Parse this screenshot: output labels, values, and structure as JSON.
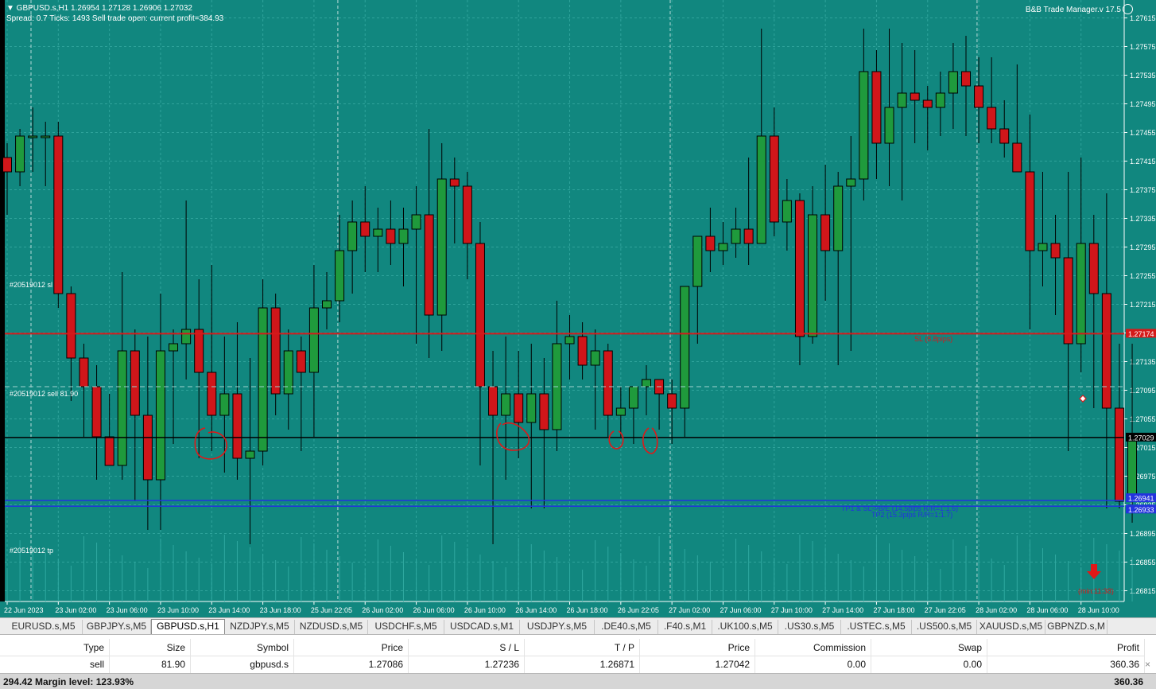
{
  "theme": {
    "chart_background": "#11877f",
    "bull_color": "#1f9a3c",
    "bear_color": "#d0161a",
    "grid_color": "#2fa39b",
    "sl_line_color": "#d51a1a",
    "price_line_color": "#000000",
    "tp_line_color": "#2233dd",
    "annotation_color": "#e01818"
  },
  "chart_header": {
    "line1": "▼ GBPUSD.s,H1  1.26954 1.27128 1.26906 1.27032",
    "line2": "Spread: 0.7  Ticks: 1493  Sell trade open: current profit=384.93",
    "ea_label": "B&B Trade Manager.v 17.5"
  },
  "order_labels": {
    "sl": "#20519012 sl",
    "entry": "#20519012 sell 81.90",
    "tp": "#20519012 tp"
  },
  "line_texts": {
    "sl": "SL (8.8pips)",
    "tp1": "TP1 & SL->B/E (14.5pips R/R=1:1.6)",
    "tp2": "TP2 (15.3pips R/R=1:1.7)",
    "timer": "(min:11:38)"
  },
  "chart_data": {
    "type": "candlestick",
    "symbol": "GBPUSD.s",
    "timeframe": "H1",
    "ylim": [
      1.2681,
      1.2763
    ],
    "y_ticks": [
      1.27615,
      1.27575,
      1.27535,
      1.27495,
      1.27455,
      1.27415,
      1.27375,
      1.27335,
      1.27295,
      1.27255,
      1.27215,
      1.27175,
      1.27135,
      1.27095,
      1.27055,
      1.27015,
      1.26975,
      1.26935,
      1.26895,
      1.26855,
      1.26815
    ],
    "x_labels": [
      {
        "i": 0,
        "label": "22 Jun 2023"
      },
      {
        "i": 4,
        "label": "23 Jun 02:00"
      },
      {
        "i": 8,
        "label": "23 Jun 06:00"
      },
      {
        "i": 12,
        "label": "23 Jun 10:00"
      },
      {
        "i": 16,
        "label": "23 Jun 14:00"
      },
      {
        "i": 20,
        "label": "23 Jun 18:00"
      },
      {
        "i": 24,
        "label": "25 Jun 22:05"
      },
      {
        "i": 28,
        "label": "26 Jun 02:00"
      },
      {
        "i": 32,
        "label": "26 Jun 06:00"
      },
      {
        "i": 36,
        "label": "26 Jun 10:00"
      },
      {
        "i": 40,
        "label": "26 Jun 14:00"
      },
      {
        "i": 44,
        "label": "26 Jun 18:00"
      },
      {
        "i": 48,
        "label": "26 Jun 22:05"
      },
      {
        "i": 52,
        "label": "27 Jun 02:00"
      },
      {
        "i": 56,
        "label": "27 Jun 06:00"
      },
      {
        "i": 60,
        "label": "27 Jun 10:00"
      },
      {
        "i": 64,
        "label": "27 Jun 14:00"
      },
      {
        "i": 68,
        "label": "27 Jun 18:00"
      },
      {
        "i": 72,
        "label": "27 Jun 22:05"
      },
      {
        "i": 76,
        "label": "28 Jun 02:00"
      },
      {
        "i": 80,
        "label": "28 Jun 06:00"
      },
      {
        "i": 84,
        "label": "28 Jun 10:00"
      }
    ],
    "period_separators": [
      0,
      24,
      50,
      74
    ],
    "candles": [
      [
        1.2742,
        1.2744,
        1.2734,
        1.274
      ],
      [
        1.274,
        1.2746,
        1.2738,
        1.2745
      ],
      [
        1.2745,
        1.2749,
        1.274,
        1.2745
      ],
      [
        1.2745,
        1.2747,
        1.2738,
        1.2745
      ],
      [
        1.2745,
        1.2747,
        1.2721,
        1.2723
      ],
      [
        1.2723,
        1.2724,
        1.2708,
        1.2714
      ],
      [
        1.2714,
        1.2716,
        1.2703,
        1.271
      ],
      [
        1.271,
        1.2713,
        1.2697,
        1.2703
      ],
      [
        1.2703,
        1.2709,
        1.2701,
        1.2699
      ],
      [
        1.2699,
        1.2726,
        1.2697,
        1.2715
      ],
      [
        1.2715,
        1.2718,
        1.2694,
        1.2706
      ],
      [
        1.2706,
        1.2717,
        1.269,
        1.2697
      ],
      [
        1.2697,
        1.2723,
        1.269,
        1.2715
      ],
      [
        1.2715,
        1.2718,
        1.2702,
        1.2716
      ],
      [
        1.2716,
        1.2736,
        1.2711,
        1.2718
      ],
      [
        1.2718,
        1.2725,
        1.27,
        1.2712
      ],
      [
        1.2712,
        1.2727,
        1.2701,
        1.2706
      ],
      [
        1.2706,
        1.2717,
        1.2698,
        1.2709
      ],
      [
        1.2709,
        1.2719,
        1.2697,
        1.27
      ],
      [
        1.27,
        1.2714,
        1.2688,
        1.2701
      ],
      [
        1.2701,
        1.2725,
        1.2699,
        1.2721
      ],
      [
        1.2721,
        1.2723,
        1.2706,
        1.2709
      ],
      [
        1.2709,
        1.2718,
        1.2704,
        1.2715
      ],
      [
        1.2715,
        1.2717,
        1.2701,
        1.2712
      ],
      [
        1.2712,
        1.2727,
        1.2703,
        1.2721
      ],
      [
        1.2721,
        1.2726,
        1.2718,
        1.2722
      ],
      [
        1.2722,
        1.2734,
        1.2719,
        1.2729
      ],
      [
        1.2729,
        1.2736,
        1.2723,
        1.2733
      ],
      [
        1.2733,
        1.2738,
        1.2726,
        1.2731
      ],
      [
        1.2731,
        1.2735,
        1.2726,
        1.2732
      ],
      [
        1.2732,
        1.2736,
        1.2727,
        1.273
      ],
      [
        1.273,
        1.2735,
        1.2724,
        1.2732
      ],
      [
        1.2732,
        1.2738,
        1.2716,
        1.2734
      ],
      [
        1.2734,
        1.2746,
        1.2714,
        1.272
      ],
      [
        1.272,
        1.2744,
        1.2715,
        1.2739
      ],
      [
        1.2739,
        1.2742,
        1.273,
        1.2738
      ],
      [
        1.2738,
        1.274,
        1.2725,
        1.273
      ],
      [
        1.273,
        1.2733,
        1.2699,
        1.271
      ],
      [
        1.271,
        1.2715,
        1.2688,
        1.2706
      ],
      [
        1.2706,
        1.2717,
        1.2697,
        1.2709
      ],
      [
        1.2709,
        1.2715,
        1.27,
        1.2705
      ],
      [
        1.2705,
        1.2716,
        1.2693,
        1.2709
      ],
      [
        1.2709,
        1.2714,
        1.2693,
        1.2704
      ],
      [
        1.2704,
        1.2722,
        1.2701,
        1.2716
      ],
      [
        1.2716,
        1.272,
        1.2711,
        1.2717
      ],
      [
        1.2717,
        1.2719,
        1.2711,
        1.2713
      ],
      [
        1.2713,
        1.2718,
        1.2704,
        1.2715
      ],
      [
        1.2715,
        1.2716,
        1.2703,
        1.2706
      ],
      [
        1.2706,
        1.271,
        1.2703,
        1.2707
      ],
      [
        1.2707,
        1.271,
        1.2702,
        1.271
      ],
      [
        1.271,
        1.2713,
        1.2706,
        1.2711
      ],
      [
        1.2711,
        1.2711,
        1.2704,
        1.2709
      ],
      [
        1.2709,
        1.2711,
        1.2702,
        1.2707
      ],
      [
        1.2707,
        1.2718,
        1.2703,
        1.2724
      ],
      [
        1.2724,
        1.2731,
        1.2716,
        1.2731
      ],
      [
        1.2731,
        1.2735,
        1.2726,
        1.2729
      ],
      [
        1.2729,
        1.2733,
        1.2727,
        1.273
      ],
      [
        1.273,
        1.2735,
        1.2728,
        1.2732
      ],
      [
        1.2732,
        1.2742,
        1.2727,
        1.273
      ],
      [
        1.273,
        1.276,
        1.273,
        1.2745
      ],
      [
        1.2745,
        1.2749,
        1.2731,
        1.2733
      ],
      [
        1.2733,
        1.2739,
        1.2729,
        1.2736
      ],
      [
        1.2736,
        1.2737,
        1.2713,
        1.2717
      ],
      [
        1.2717,
        1.2738,
        1.2716,
        1.2734
      ],
      [
        1.2734,
        1.2741,
        1.2722,
        1.2729
      ],
      [
        1.2729,
        1.274,
        1.2713,
        1.2738
      ],
      [
        1.2738,
        1.2745,
        1.2715,
        1.2739
      ],
      [
        1.2739,
        1.276,
        1.2736,
        1.2754
      ],
      [
        1.2754,
        1.2757,
        1.2739,
        1.2744
      ],
      [
        1.2744,
        1.276,
        1.2738,
        1.2749
      ],
      [
        1.2749,
        1.2758,
        1.2736,
        1.2751
      ],
      [
        1.2751,
        1.2757,
        1.2744,
        1.275
      ],
      [
        1.275,
        1.2752,
        1.2743,
        1.2749
      ],
      [
        1.2749,
        1.2754,
        1.2745,
        1.2751
      ],
      [
        1.2751,
        1.2758,
        1.2746,
        1.2754
      ],
      [
        1.2754,
        1.2759,
        1.2745,
        1.2752
      ],
      [
        1.2752,
        1.2756,
        1.2744,
        1.2749
      ],
      [
        1.2749,
        1.2756,
        1.2744,
        1.2746
      ],
      [
        1.2746,
        1.275,
        1.2742,
        1.2744
      ],
      [
        1.2744,
        1.2755,
        1.2743,
        1.274
      ],
      [
        1.274,
        1.2748,
        1.2718,
        1.2729
      ],
      [
        1.2729,
        1.274,
        1.2724,
        1.273
      ],
      [
        1.273,
        1.2734,
        1.272,
        1.2728
      ],
      [
        1.2728,
        1.274,
        1.2701,
        1.2716
      ],
      [
        1.2716,
        1.2742,
        1.2712,
        1.273
      ],
      [
        1.273,
        1.2734,
        1.2707,
        1.2723
      ],
      [
        1.2723,
        1.2737,
        1.2693,
        1.2707
      ],
      [
        1.2707,
        1.2716,
        1.2693,
        1.2694
      ],
      [
        1.2694,
        1.2716,
        1.2691,
        1.2703
      ]
    ],
    "levels": {
      "sl": 1.27174,
      "current": 1.27029,
      "tp1": 1.26941,
      "tp2": 1.26933
    },
    "axis_price_labels": {
      "sl": "1.27174",
      "current": "1.27029",
      "tp1": "1.26941",
      "tp2": "1.26933"
    }
  },
  "tabs": {
    "active": 2,
    "items": [
      "EURUSD.s,M5",
      "GBPJPY.s,M5",
      "GBPUSD.s,H1",
      "NZDJPY.s,M5",
      "NZDUSD.s,M5",
      "USDCHF.s,M5",
      "USDCAD.s,M1",
      "USDJPY.s,M5",
      ".DE40.s,M5",
      ".F40.s,M1",
      ".UK100.s,M5",
      ".US30.s,M5",
      ".USTEC.s,M5",
      ".US500.s,M5",
      "XAUUSD.s,M5",
      "GBPNZD.s,M"
    ]
  },
  "trade_table": {
    "headers": [
      "Type",
      "Size",
      "Symbol",
      "Price",
      "S / L",
      "T / P",
      "Price",
      "Commission",
      "Swap",
      "Profit"
    ],
    "rows": [
      [
        "sell",
        "81.90",
        "gbpusd.s",
        "1.27086",
        "1.27236",
        "1.26871",
        "1.27042",
        "0.00",
        "0.00",
        "360.36"
      ]
    ],
    "close_symbol": "×"
  },
  "summary": {
    "text": "294.42  Margin level: 123.93%",
    "profit": "360.36"
  }
}
